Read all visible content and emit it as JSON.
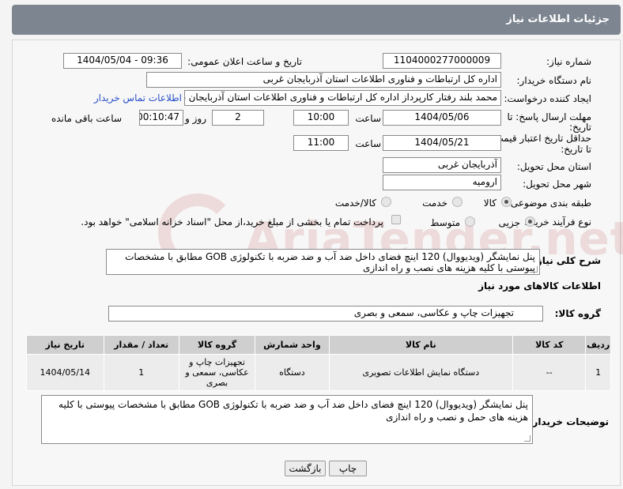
{
  "header": {
    "title": "جزئیات اطلاعات نیاز"
  },
  "fields": {
    "need_number_label": "شماره نیاز:",
    "need_number": "1104000277000009",
    "announce_label": "تاریخ و ساعت اعلان عمومی:",
    "announce_value": "1404/05/04 - 09:36",
    "buyer_org_label": "نام دستگاه خریدار:",
    "buyer_org": "اداره کل ارتباطات و فناوری اطلاعات استان آذربایجان غربی",
    "creator_label": "ایجاد کننده درخواست:",
    "creator": "محمد بلند رفتار کارپرداز اداره کل ارتباطات و فناوری اطلاعات استان آذربایجان غربی",
    "contact_link": "اطلاعات تماس خریدار",
    "deadline_label_1": "مهلت ارسال پاسخ: تا",
    "deadline_label_2": "تاریخ:",
    "deadline_date": "1404/05/06",
    "hour_label": "ساعت",
    "deadline_time": "10:00",
    "days_value": "2",
    "days_label": "روز و",
    "remaining_time": "00:10:47",
    "remaining_label": "ساعت باقی مانده",
    "validity_label_1": "حداقل تاریخ اعتبار قیمت:",
    "validity_label_2": "تا تاریخ:",
    "validity_date": "1404/05/21",
    "validity_time": "11:00",
    "province_label": "استان محل تحویل:",
    "province": "آذربایجان غربی",
    "city_label": "شهر محل تحویل:",
    "city": "ارومیه",
    "category_label": "طبقه بندی موضوعی:",
    "category_options": [
      "کالا",
      "خدمت",
      "کالا/خدمت"
    ],
    "process_label": "نوع فرآیند خرید :",
    "process_options": [
      "جزیی",
      "متوسط"
    ],
    "payment_note": "پرداخت تمام یا بخشی از مبلغ خرید،از محل \"اسناد خزانه اسلامی\" خواهد بود.",
    "summary_label": "شرح کلی نیاز:",
    "summary_text": "پنل نمایشگر (ویدیووال) 120 اینچ فضای داخل ضد آب و ضد ضربه با تکنولوژی GOB  مطابق با مشخصات پیوستی با کلیه هزینه های نصب و راه اندازی"
  },
  "goods_section": {
    "title": "اطلاعات کالاهای مورد نیاز",
    "group_label": "گروه کالا:",
    "group_value": "تجهیزات چاپ و عکاسی، سمعی و بصری"
  },
  "table": {
    "headers": [
      "ردیف",
      "کد کالا",
      "نام کالا",
      "واحد شمارش",
      "گروه کالا",
      "تعداد / مقدار",
      "تاریخ نیاز"
    ],
    "rows": [
      [
        "1",
        "--",
        "دستگاه نمایش اطلاعات تصویری",
        "دستگاه",
        "تجهیزات چاپ و عکاسی، سمعی و بصری",
        "1",
        "1404/05/14"
      ]
    ]
  },
  "buyer_notes": {
    "label": "توضیحات خریدار:",
    "text": "پنل نمایشگر (ویدیووال) 120 اینچ فضای داخل ضد آب و ضد ضربه با تکنولوژی GOB  مطابق با مشخصات پیوستی با کلیه هزینه های حمل و نصب و راه اندازی"
  },
  "buttons": {
    "print": "چاپ",
    "back": "بازگشت"
  },
  "colors": {
    "header_bg": "#7d8590",
    "link": "#2a50c8",
    "table_header": "#cfcfcf"
  }
}
